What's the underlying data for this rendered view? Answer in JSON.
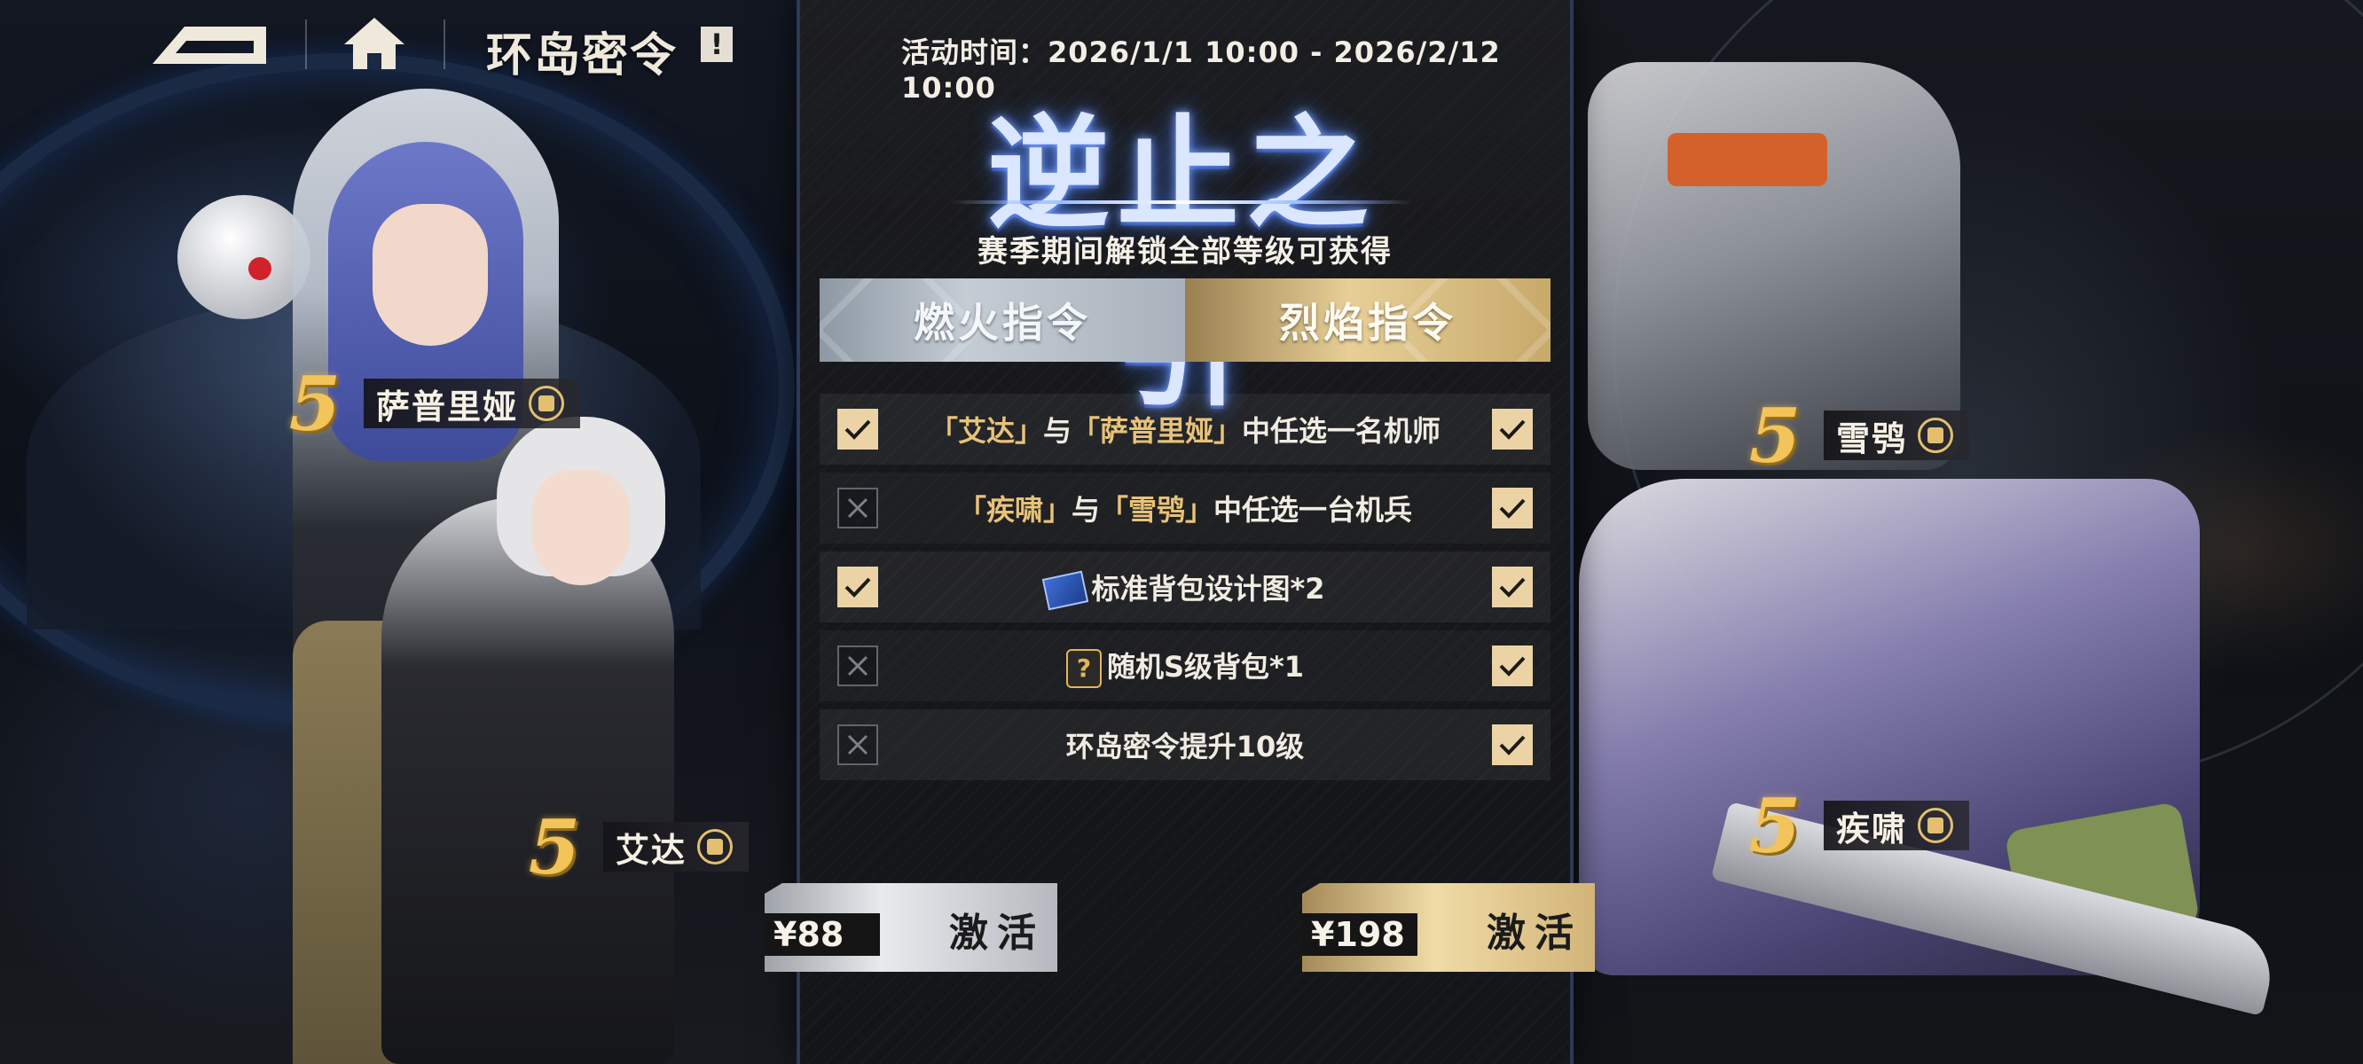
{
  "nav": {
    "title": "环岛密令",
    "info_glyph": "!"
  },
  "event": {
    "time_label": "活动时间：2026/1/1 10:00 - 2026/2/12 10:00",
    "title": "逆止之引",
    "subtitle": "赛季期间解锁全部等级可获得"
  },
  "tabs": [
    {
      "label": "燃火指令"
    },
    {
      "label": "烈焰指令"
    }
  ],
  "rewards": [
    {
      "parts": [
        "「艾达」",
        "与",
        "「萨普里娅」",
        "中任选一名机师"
      ],
      "spark": true,
      "blaze": true
    },
    {
      "parts": [
        "「疾啸」",
        "与",
        "「雪鸮」",
        "中任选一台机兵"
      ],
      "spark": false,
      "blaze": true
    },
    {
      "text": "标准背包设计图*2",
      "icon": "blueprint-icon",
      "spark": true,
      "blaze": true
    },
    {
      "text": "随机S级背包*1",
      "icon": "random-pack-icon",
      "icon_glyph": "?",
      "spark": false,
      "blaze": true
    },
    {
      "text": "环岛密令提升10级",
      "spark": false,
      "blaze": true
    }
  ],
  "purchase": [
    {
      "price": "¥88",
      "label": "激活"
    },
    {
      "price": "¥198",
      "label": "激活"
    }
  ],
  "characters": [
    {
      "rank": "5",
      "name": "萨普里娅"
    },
    {
      "rank": "5",
      "name": "艾达"
    },
    {
      "rank": "5",
      "name": "雪鸮"
    },
    {
      "rank": "5",
      "name": "疾啸"
    }
  ],
  "colors": {
    "gold_accent": "#e8c27a",
    "check_on": "#ecd3a6",
    "title_glow": "#7fa6ff"
  }
}
